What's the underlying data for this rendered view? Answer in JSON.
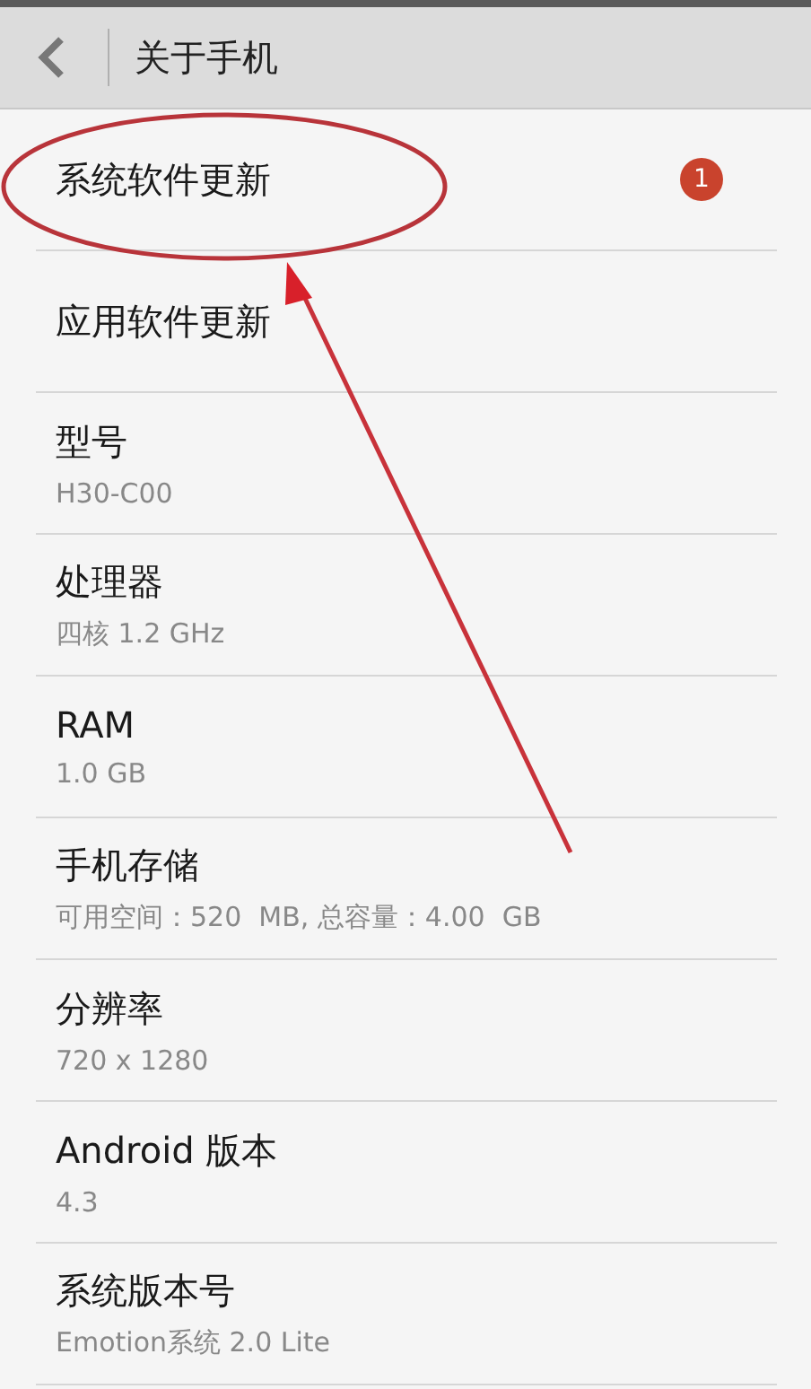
{
  "header": {
    "title": "关于手机"
  },
  "items": [
    {
      "title": "系统软件更新",
      "badge": "1"
    },
    {
      "title": "应用软件更新"
    },
    {
      "title": "型号",
      "subtitle": "H30-C00"
    },
    {
      "title": "处理器",
      "subtitle": "四核 1.2 GHz"
    },
    {
      "title": "RAM",
      "subtitle": "1.0 GB"
    },
    {
      "title": "手机存储",
      "subtitle": "可用空间：520  MB, 总容量：4.00  GB"
    },
    {
      "title": "分辨率",
      "subtitle": "720 x 1280"
    },
    {
      "title": "Android 版本",
      "subtitle": "4.3"
    },
    {
      "title": "系统版本号",
      "subtitle": "Emotion系统 2.0 Lite"
    }
  ]
}
